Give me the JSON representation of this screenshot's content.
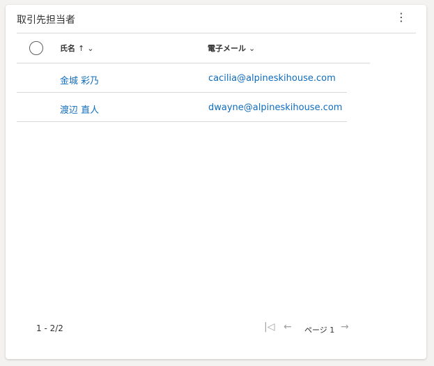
{
  "header": {
    "title": "取引先担当者",
    "more_icon": "more-vertical-icon"
  },
  "columns": [
    {
      "label": "氏名",
      "sort": "ascending"
    },
    {
      "label": "電子メール"
    }
  ],
  "rows": [
    {
      "name": "金城 彩乃",
      "email": "cacilia@alpineskihouse.com"
    },
    {
      "name": "渡辺 直人",
      "email": "dwayne@alpineskihouse.com"
    }
  ],
  "footer": {
    "count": "1 - 2/2",
    "page_label": "ページ 1"
  },
  "colors": {
    "link": "#0f6cbd"
  }
}
